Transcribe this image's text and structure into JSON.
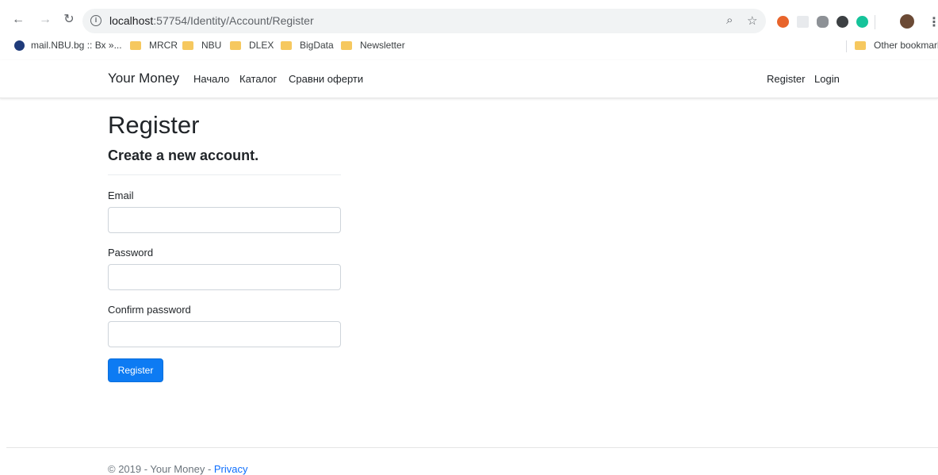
{
  "browser": {
    "url_host": "localhost",
    "url_rest": ":57754/Identity/Account/Register",
    "bookmarks": [
      {
        "label": "mail.NBU.bg :: Вх »..."
      },
      {
        "label": "MRCR"
      },
      {
        "label": "NBU"
      },
      {
        "label": "DLEX"
      },
      {
        "label": "BigData"
      },
      {
        "label": "Newsletter"
      }
    ],
    "other_bookmarks": "Other bookmarks"
  },
  "nav": {
    "brand": "Your Money",
    "links": [
      "Начало",
      "Каталог",
      "Сравни оферти"
    ],
    "register": "Register",
    "login": "Login"
  },
  "page": {
    "title": "Register",
    "subtitle": "Create a new account.",
    "email_label": "Email",
    "email_value": "",
    "password_label": "Password",
    "password_value": "",
    "confirm_label": "Confirm password",
    "confirm_value": "",
    "submit_label": "Register"
  },
  "footer": {
    "copyright": "© 2019 - Your Money - ",
    "privacy": "Privacy"
  },
  "colors": {
    "primary": "#0d7bf3",
    "folder": "#f6c85f"
  }
}
